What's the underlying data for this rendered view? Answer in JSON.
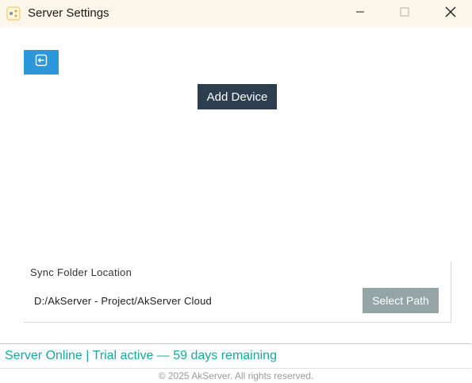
{
  "window": {
    "title": "Server Settings",
    "icon": "app-logo-icon",
    "controls": {
      "minimize_icon": "minimize-icon",
      "maximize_icon": "maximize-icon",
      "close_icon": "close-icon"
    }
  },
  "toolbar": {
    "back_icon": "back-icon",
    "back_color": "#2d97dc"
  },
  "main": {
    "add_device_label": "Add Device",
    "add_device_color": "#2c3e50"
  },
  "sync": {
    "label": "Sync Folder Location",
    "path": "D:/AkServer - Project/AkServer Cloud",
    "select_path_label": "Select Path",
    "select_path_color": "#95a5a6"
  },
  "status": {
    "text": "Server Online | Trial active — 59 days remaining",
    "color": "#1aa89a"
  },
  "footer": {
    "copyright": "© 2025 AkServer. All rights reserved."
  }
}
